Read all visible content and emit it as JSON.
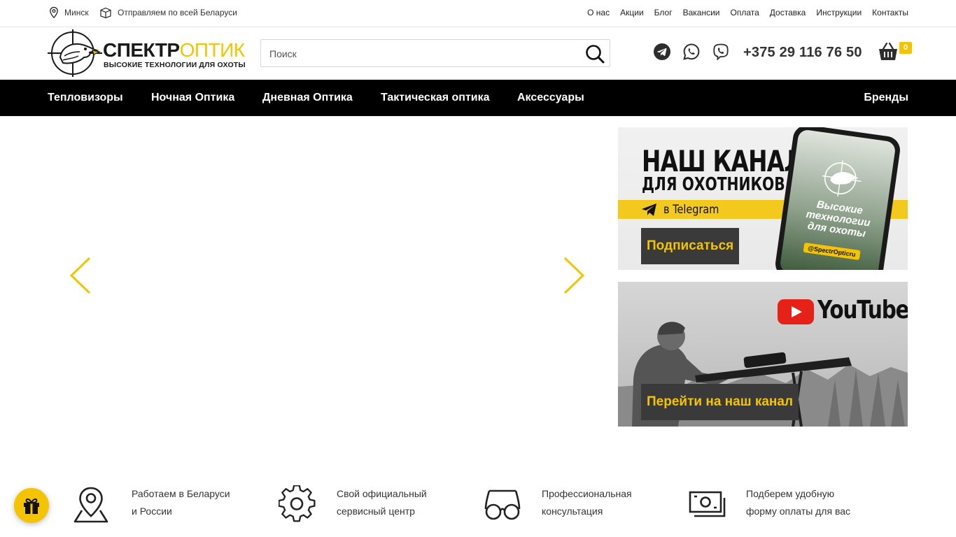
{
  "topbar": {
    "city": "Минск",
    "shipping": "Отправляем по всей Беларуси",
    "links": [
      "О нас",
      "Акции",
      "Блог",
      "Вакансии",
      "Оплата",
      "Доставка",
      "Инструкции",
      "Контакты"
    ]
  },
  "header": {
    "logo": {
      "brand_dark": "СПЕКТР",
      "brand_yellow": "ОПТИК",
      "slogan": "ВЫСОКИЕ ТЕХНОЛОГИИ ДЛЯ ОХОТЫ"
    },
    "search": {
      "placeholder": "Поиск",
      "value": ""
    },
    "social": [
      "telegram-icon",
      "whatsapp-icon",
      "viber-icon"
    ],
    "phone": "+375 29 116 76 50",
    "cart_count": "0"
  },
  "nav": {
    "items": [
      "Тепловизоры",
      "Ночная Оптика",
      "Дневная Оптика",
      "Тактическая оптика",
      "Аксессуары"
    ],
    "brands": "Бренды"
  },
  "banners": {
    "telegram": {
      "title_line1": "НАШ КАНАЛ",
      "title_line2": "ДЛЯ ОХОТНИКОВ",
      "strip_text": "в Telegram",
      "phone_text": "Высокие технологии для охоты",
      "phone_tag": "@SpectrOpticru",
      "button": "Подписаться"
    },
    "youtube": {
      "logo_text": "YouTube",
      "button": "Перейти на наш канал"
    }
  },
  "features": [
    {
      "icon": "map-pin-icon",
      "line1": "Работаем в Беларуси",
      "line2": "и России"
    },
    {
      "icon": "gear-icon",
      "line1": "Свой официальный",
      "line2": "сервисный центр"
    },
    {
      "icon": "glasses-icon",
      "line1": "Профессиональная",
      "line2": "консультация"
    },
    {
      "icon": "money-icon",
      "line1": "Подберем удобную",
      "line2": "форму оплаты для вас"
    }
  ],
  "colors": {
    "accent": "#f4c400",
    "nav_bg": "#000000",
    "button_bg": "#3a3a3a"
  }
}
